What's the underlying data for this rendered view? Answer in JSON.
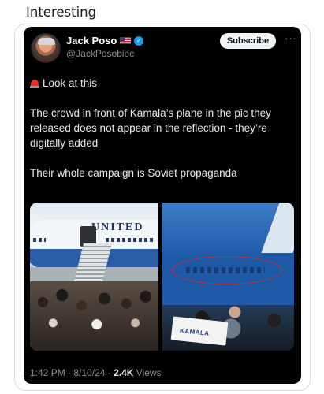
{
  "page": {
    "heading": "Interesting"
  },
  "tweet": {
    "author": {
      "display_name": "Jack Poso",
      "handle": "@JackPosobiec"
    },
    "subscribe_label": "Subscribe",
    "more_label": "···",
    "text_line1": "Look at this",
    "text_para2": "The crowd in front of Kamala’s plane in the pic they released does not appear in the reflection - they’re digitally added",
    "text_para3": "Their whole campaign is Soviet propaganda",
    "media": {
      "plane_label": "UNITED",
      "sign_label": "KAMALA"
    },
    "meta": {
      "time": "1:42 PM",
      "separator": " · ",
      "date": "8/10/24",
      "views_count": "2.4K",
      "views_label": " Views"
    }
  },
  "icons": [
    "flag-icon",
    "verified-icon",
    "siren-icon",
    "more-icon"
  ],
  "colors": {
    "tweet_bg": "#000000",
    "verified": "#1d9bf0",
    "siren": "#e0332e",
    "highlight_circle": "#c8303a"
  }
}
